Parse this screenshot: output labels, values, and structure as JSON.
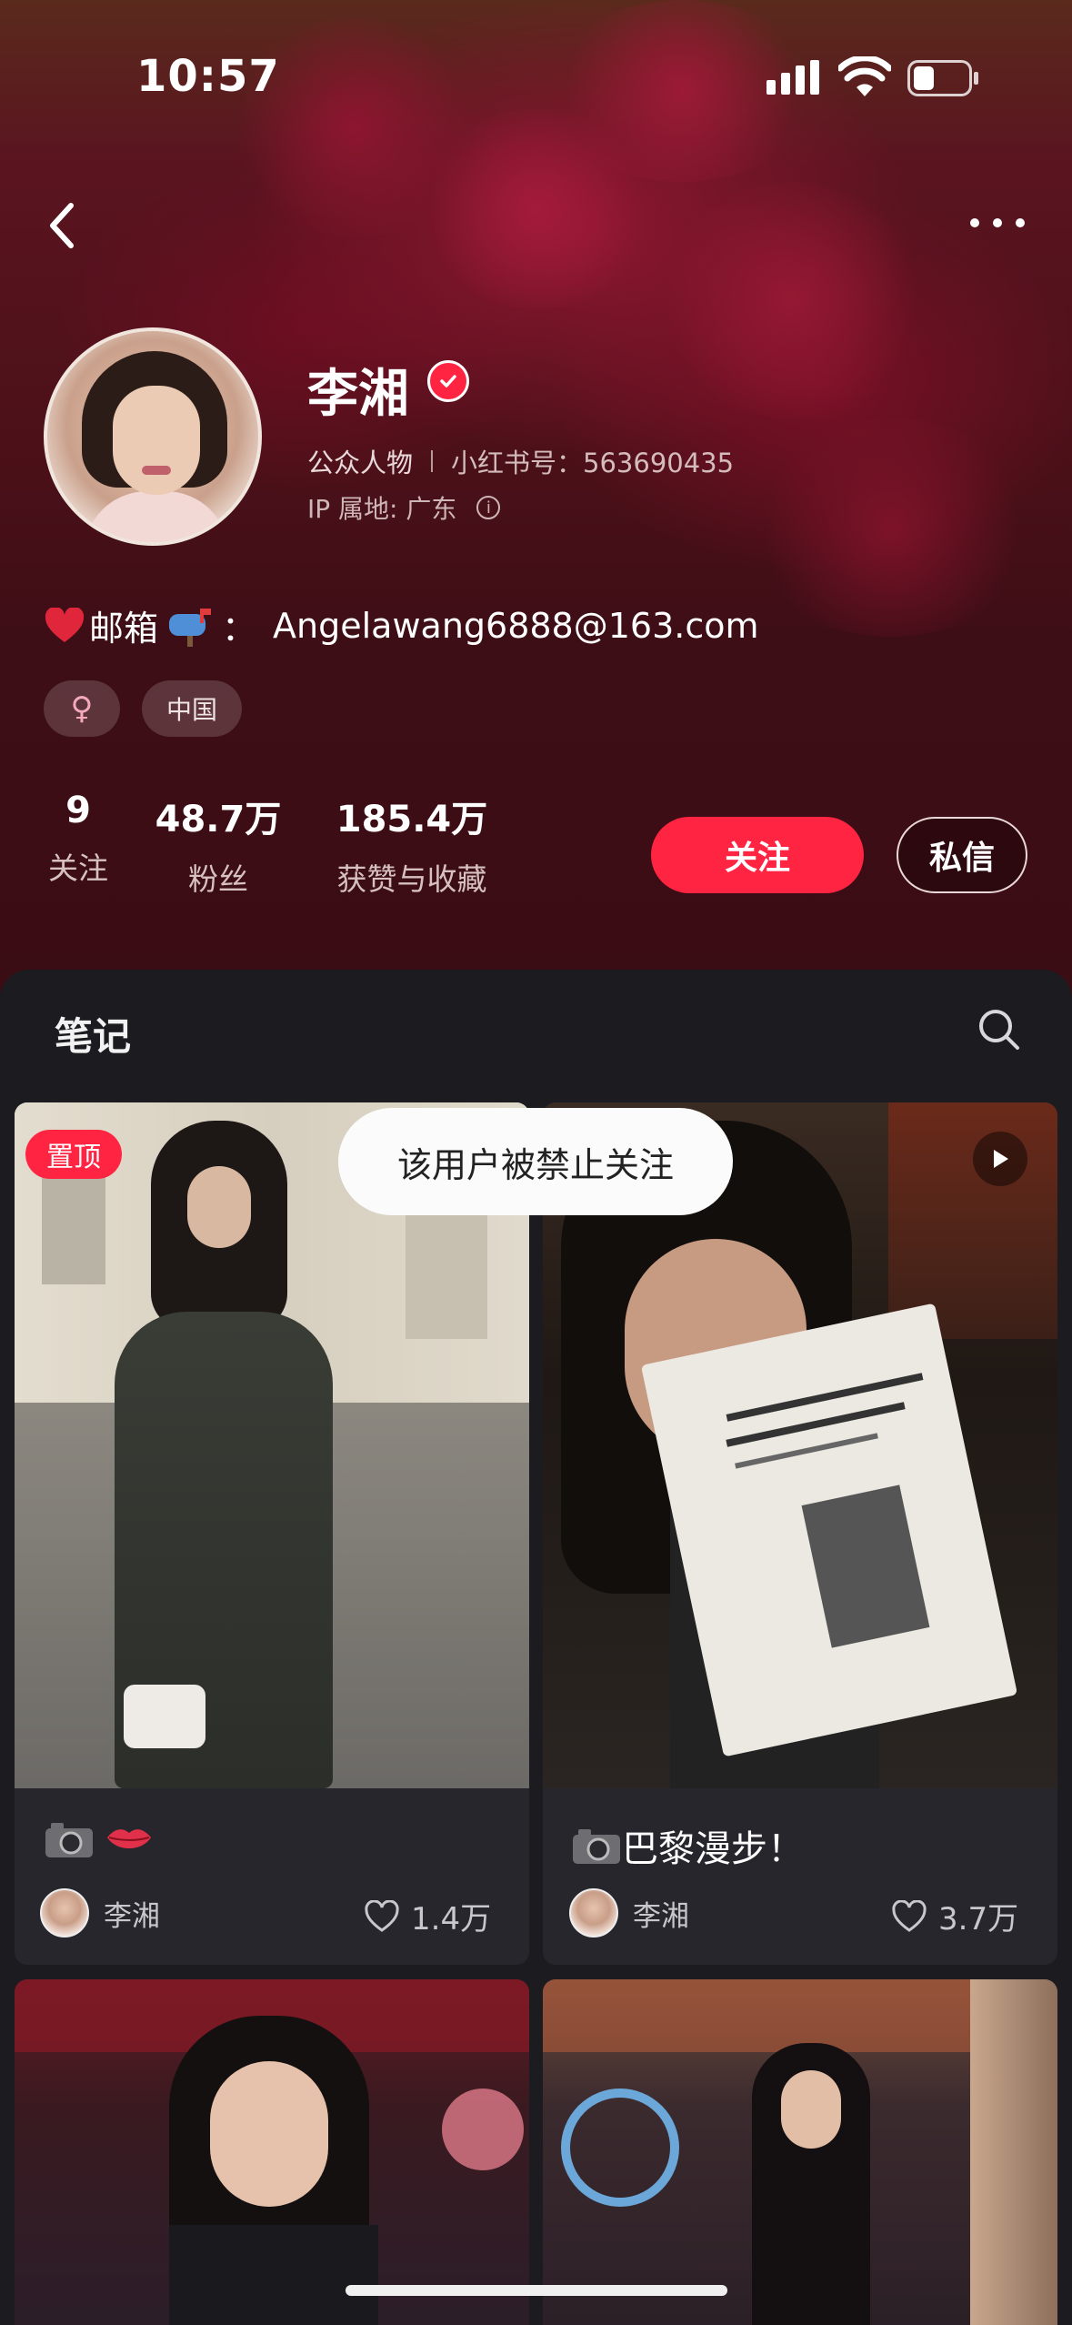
{
  "status_bar": {
    "time": "10:57"
  },
  "profile": {
    "name": "李湘",
    "category": "公众人物",
    "xhs_id": "小红书号：563690435",
    "ip_location": "IP 属地: 广东",
    "bio_prefix": "邮箱",
    "bio_email": "Angelawang6888@163.com",
    "tags": {
      "gender": "♀",
      "region": "中国"
    }
  },
  "stats": {
    "following": {
      "value": "9",
      "label": "关注"
    },
    "fans": {
      "value": "48.7万",
      "label": "粉丝"
    },
    "likes": {
      "value": "185.4万",
      "label": "获赞与收藏"
    }
  },
  "actions": {
    "follow_label": "关注",
    "message_label": "私信"
  },
  "notes": {
    "section_title": "笔记",
    "cards": [
      {
        "pinned_label": "置顶",
        "title": "",
        "author": "李湘",
        "likes": "1.4万"
      },
      {
        "title": "巴黎漫步！",
        "author": "李湘",
        "likes": "3.7万"
      }
    ]
  },
  "toast": {
    "message": "该用户被禁止关注"
  },
  "colors": {
    "accent": "#ff2442",
    "panel": "#1b1b20",
    "card": "#26262c"
  }
}
